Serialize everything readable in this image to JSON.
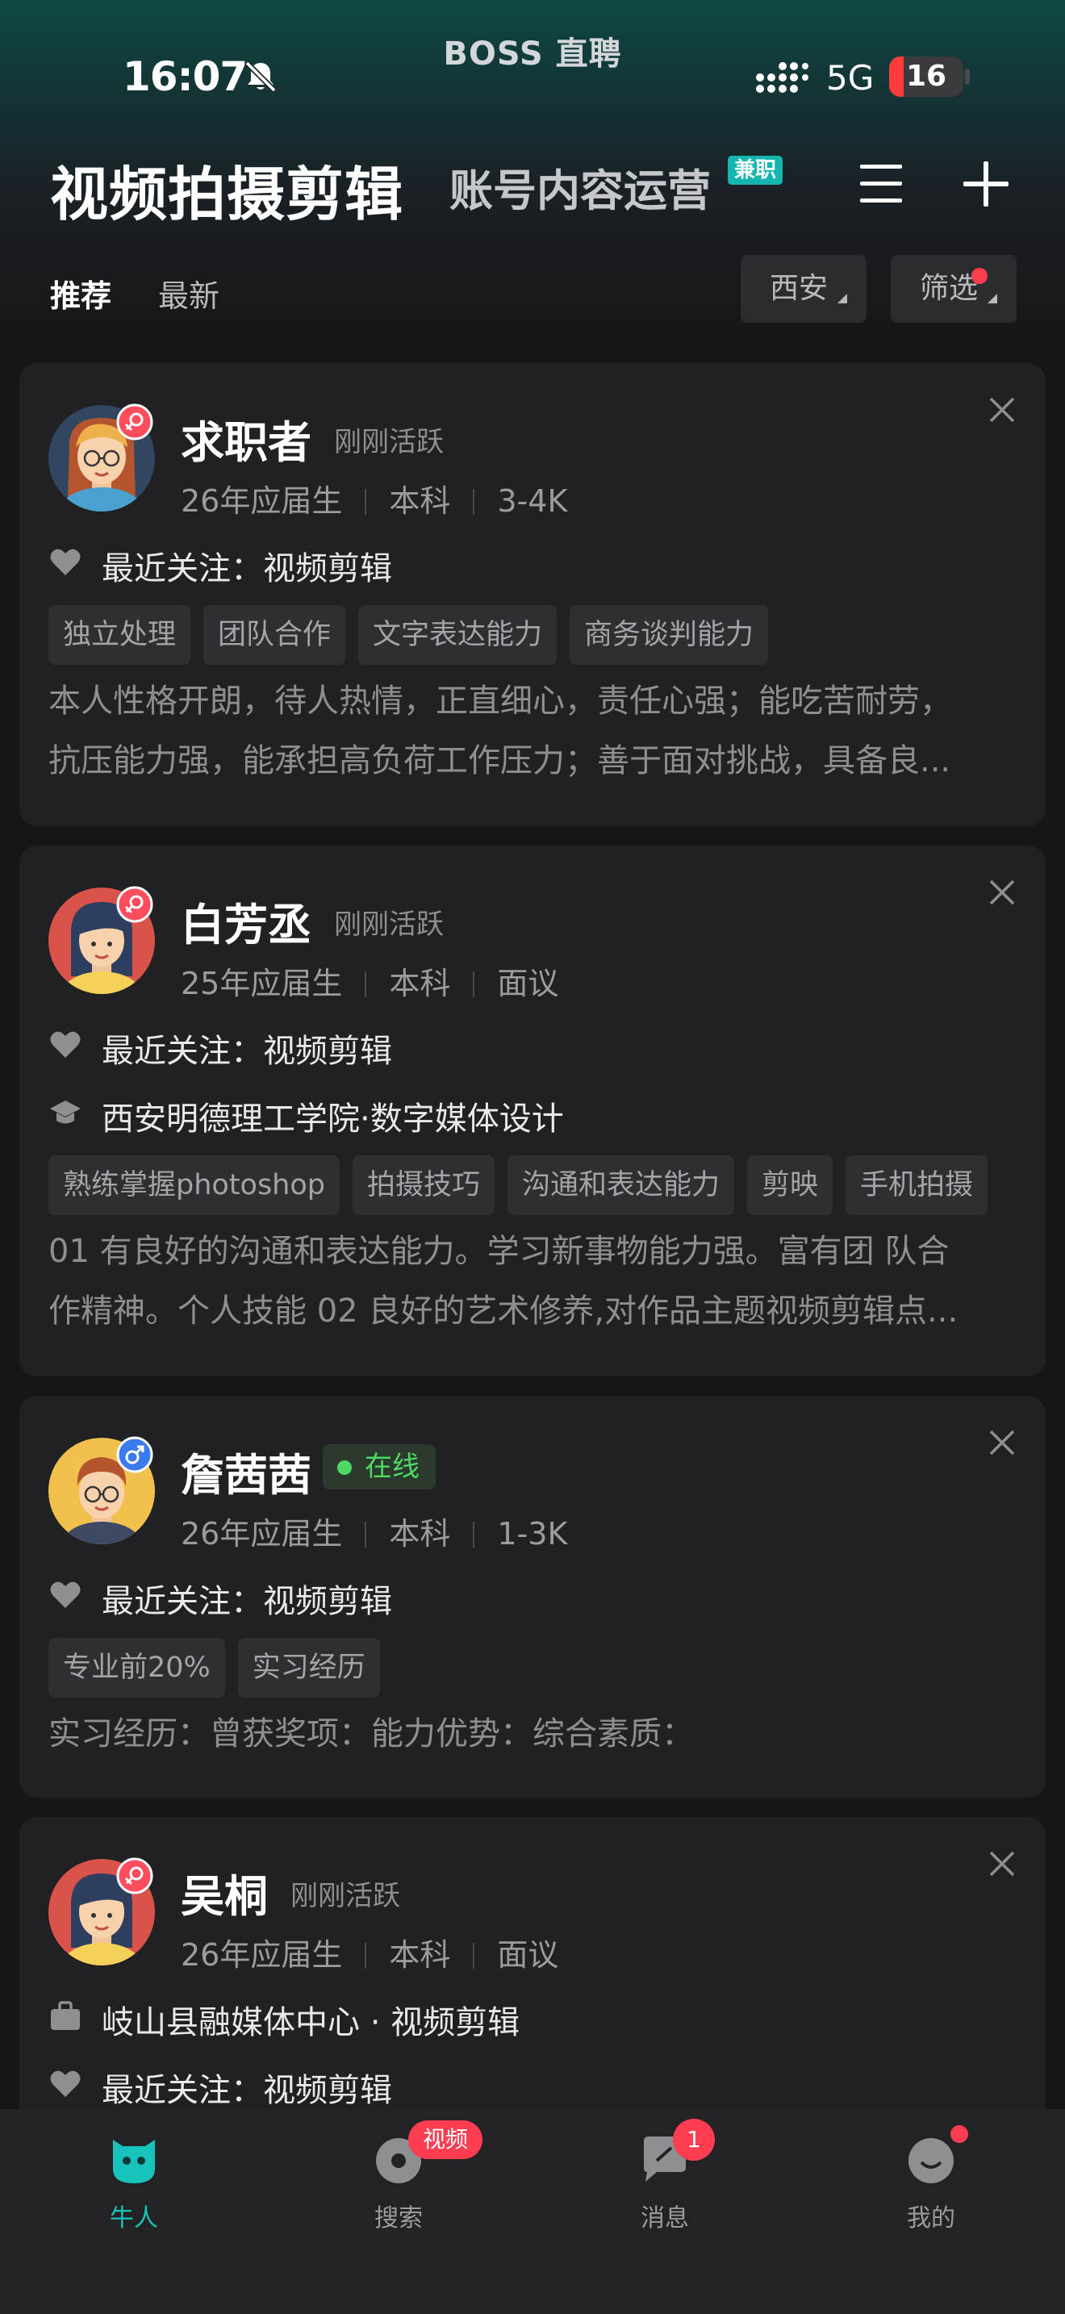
{
  "status_bar": {
    "time": "16:07",
    "carrier": "BOSS 直聘",
    "network": "5G",
    "battery": "16",
    "icons": [
      "bell-muted-icon",
      "signal-icon",
      "battery-icon"
    ]
  },
  "header": {
    "title": "视频拍摄剪辑",
    "subtitle": "账号内容运营",
    "subtitle_badge": "兼职",
    "icons": [
      "menu-icon",
      "plus-icon"
    ]
  },
  "tabs": {
    "recommend": "推荐",
    "latest": "最新"
  },
  "filters": {
    "city": "西安",
    "filter": "筛选"
  },
  "candidates": [
    {
      "name": "求职者",
      "gender": "female",
      "status": "刚刚活跃",
      "meta": [
        "26年应届生",
        "本科",
        "3-4K"
      ],
      "attention": "最近关注：视频剪辑",
      "tags": [
        "独立处理",
        "团队合作",
        "文字表达能力",
        "商务谈判能力"
      ],
      "desc": [
        "本人性格开朗，待人热情，正直细心，责任心强；能吃苦耐劳，",
        "抗压能力强，能承担高负荷工作压力；善于面对挑战，具备良..."
      ]
    },
    {
      "name": "白芳丞",
      "gender": "female",
      "status": "刚刚活跃",
      "meta": [
        "25年应届生",
        "本科",
        "面议"
      ],
      "attention": "最近关注：视频剪辑",
      "school": "西安明德理工学院·数字媒体设计",
      "tags": [
        "熟练掌握photoshop",
        "拍摄技巧",
        "沟通和表达能力",
        "剪映",
        "手机拍摄"
      ],
      "desc": [
        "01 有良好的沟通和表达能力。学习新事物能力强。富有团 队合",
        "作精神。个人技能 02 良好的艺术修养,对作品主题视频剪辑点..."
      ]
    },
    {
      "name": "詹茜茜",
      "gender": "male",
      "status": "在线",
      "meta": [
        "26年应届生",
        "本科",
        "1-3K"
      ],
      "attention": "最近关注：视频剪辑",
      "tags": [
        "专业前20%",
        "实习经历"
      ],
      "desc": [
        "实习经历：曾获奖项：能力优势：综合素质："
      ]
    },
    {
      "name": "吴桐",
      "gender": "female",
      "status": "刚刚活跃",
      "meta": [
        "26年应届生",
        "本科",
        "面议"
      ],
      "work": "岐山县融媒体中心 · 视频剪辑",
      "attention": "最近关注：视频剪辑"
    }
  ],
  "bottom_nav": {
    "talent": "牛人",
    "search": "搜索",
    "search_badge": "视频",
    "messages": "消息",
    "messages_badge": "1",
    "me": "我的"
  },
  "colors": {
    "accent": "#17c3bb",
    "badge_red": "#ff3d50",
    "online_green": "#4cd964",
    "card_bg": "#212124"
  }
}
